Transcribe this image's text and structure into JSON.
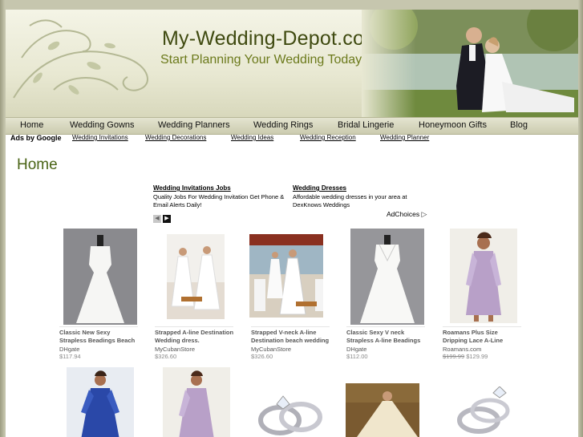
{
  "site": {
    "title": "My-Wedding-Depot.com",
    "tagline": "Start Planning Your Wedding Today!"
  },
  "nav": [
    {
      "label": "Home"
    },
    {
      "label": "Wedding Gowns"
    },
    {
      "label": "Wedding Planners"
    },
    {
      "label": "Wedding Rings"
    },
    {
      "label": "Bridal Lingerie"
    },
    {
      "label": "Honeymoon Gifts"
    },
    {
      "label": "Blog"
    }
  ],
  "adlinks": {
    "label": "Ads by Google",
    "links": [
      "Wedding Invitations",
      "Wedding Decorations",
      "Wedding Ideas",
      "Wedding Reception",
      "Wedding Planner"
    ]
  },
  "page_heading": "Home",
  "text_ads": [
    {
      "title": "Wedding Invitations Jobs",
      "desc_1": "Quality Jobs For Wedding Invitation Get Phone &",
      "desc_2": "Email Alerts Daily!"
    },
    {
      "title": "Wedding Dresses",
      "desc_1": "Affordable wedding dresses in your area at",
      "desc_2": "DexKnows Weddings"
    }
  ],
  "ad_nav": {
    "prev": "◀",
    "next": "▶"
  },
  "adchoices": {
    "label": "AdChoices",
    "icon": "▷"
  },
  "products": [
    {
      "name_1": "Classic New Sexy",
      "name_2": "Strapless Beadings Beach",
      "store": "DHgate",
      "price": "$117.94",
      "old_price": ""
    },
    {
      "name_1": "Strapped A-line Destination",
      "name_2": "Wedding dress.",
      "store": "MyCubanStore",
      "price": "$326.60",
      "old_price": ""
    },
    {
      "name_1": "Strapped V-neck A-line",
      "name_2": "Destination beach wedding",
      "store": "MyCubanStore",
      "price": "$326.60",
      "old_price": ""
    },
    {
      "name_1": "Classic Sexy V neck",
      "name_2": "Strapless A-line Beadings",
      "store": "DHgate",
      "price": "$112.00",
      "old_price": ""
    },
    {
      "name_1": "Roamans Plus Size",
      "name_2": "Dripping Lace A-Line",
      "store": "Roamans.com",
      "price": "$129.99",
      "old_price": "$199.99"
    }
  ],
  "colors": {
    "title": "#3f4a10",
    "tagline": "#6c7a1c",
    "heading": "#4a6416",
    "nav_bg": "#d6d6bc"
  }
}
